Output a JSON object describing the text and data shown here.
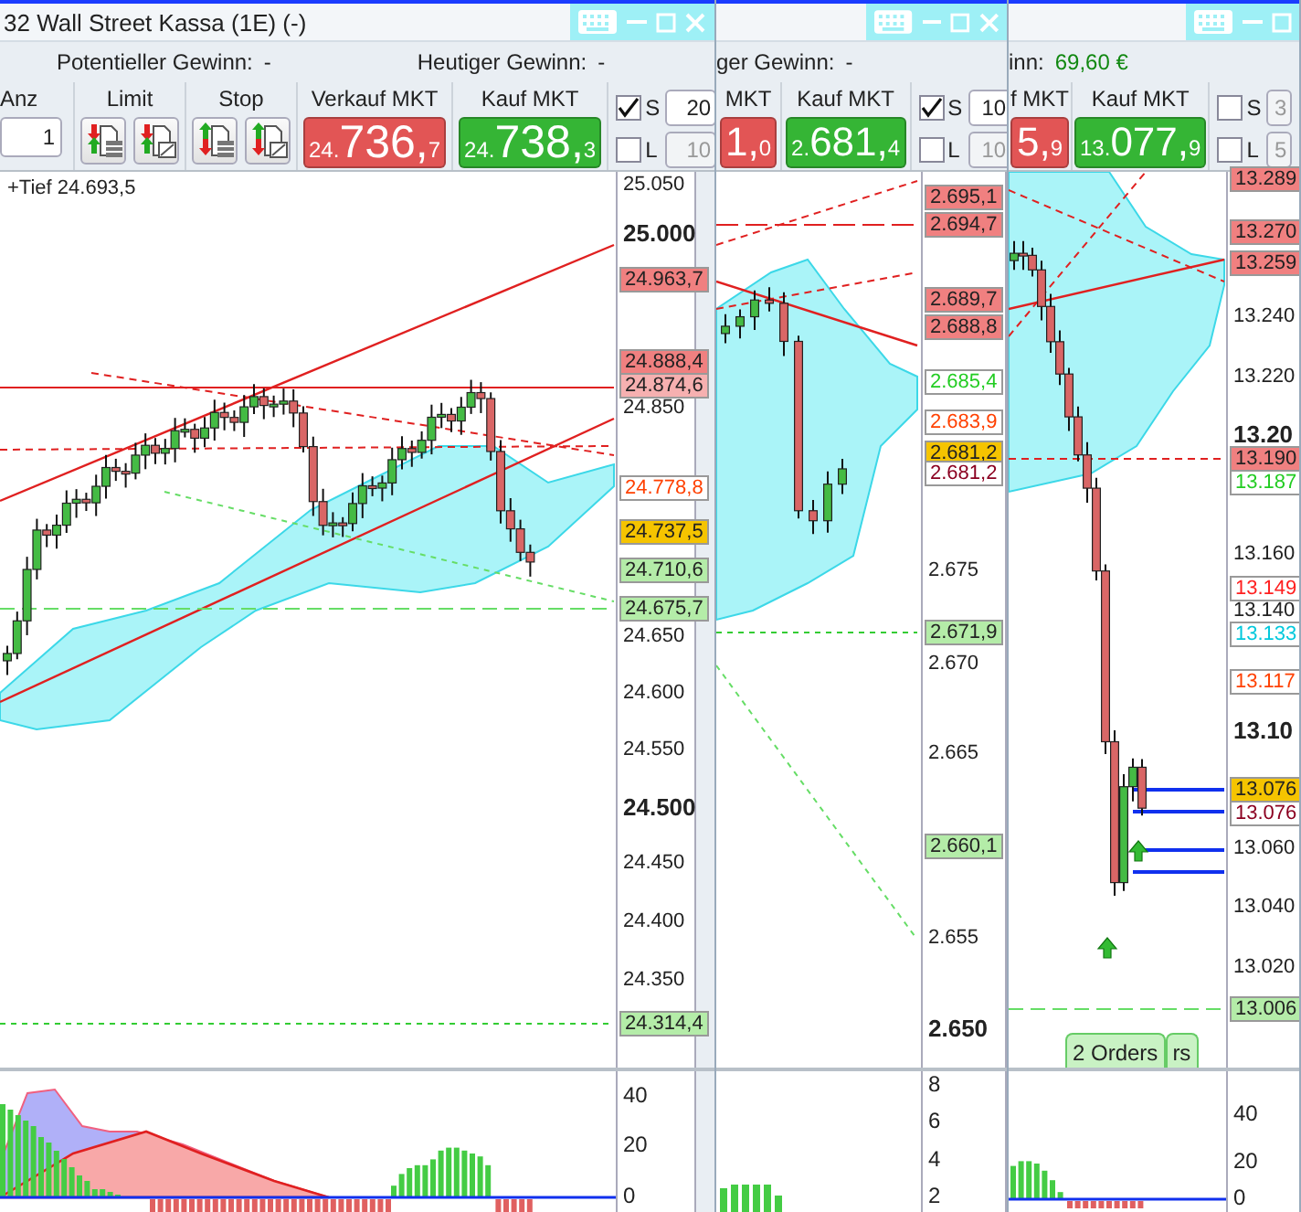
{
  "windows": [
    {
      "title": "32 Wall Street Kassa (1E) (-)",
      "info": [
        {
          "label": "Potentieller Gewinn:",
          "value": "-",
          "positive": false
        },
        {
          "label": "Heutiger Gewinn:",
          "value": "-",
          "positive": false
        }
      ],
      "toolbar": [
        {
          "kind": "quantity",
          "label": "Anz",
          "value": "1"
        },
        {
          "kind": "limit-group",
          "label": "Limit"
        },
        {
          "kind": "stop-group",
          "label": "Stop"
        },
        {
          "kind": "sell-price",
          "label": "Verkauf MKT",
          "small": "24.",
          "big": "736,",
          "sup": "7"
        },
        {
          "kind": "buy-price",
          "label": "Kauf MKT",
          "small": "24.",
          "big": "738,",
          "sup": "3"
        },
        {
          "kind": "toggles",
          "items": [
            {
              "label": "S",
              "checked": true,
              "value": "20",
              "disabled": false
            },
            {
              "label": "L",
              "checked": false,
              "value": "10",
              "disabled": true
            }
          ]
        }
      ],
      "annotation": "+Tief 24.693,5",
      "axis": [
        {
          "kind": "tick",
          "text": "25.050"
        },
        {
          "kind": "major",
          "text": "25.000"
        },
        {
          "kind": "tag",
          "text": "24.963,7",
          "color": "#f08080",
          "filled": true
        },
        {
          "kind": "tag",
          "text": "24.888,4",
          "color": "#f08080",
          "filled": true
        },
        {
          "kind": "tag",
          "text": "24.874,6",
          "color": "#f6b0b0",
          "filled": true
        },
        {
          "kind": "tick",
          "text": "24.850"
        },
        {
          "kind": "tag",
          "text": "24.778,8",
          "color": "#ff4000",
          "filled": false
        },
        {
          "kind": "tag",
          "text": "24.737,5",
          "color": "#f5c400",
          "filled": true
        },
        {
          "kind": "tag",
          "text": "24.710,6",
          "color": "#b4eca8",
          "filled": true
        },
        {
          "kind": "tag",
          "text": "24.675,7",
          "color": "#b4eca8",
          "filled": true
        },
        {
          "kind": "tick",
          "text": "24.650"
        },
        {
          "kind": "tick",
          "text": "24.600"
        },
        {
          "kind": "tick",
          "text": "24.550"
        },
        {
          "kind": "major",
          "text": "24.500"
        },
        {
          "kind": "tick",
          "text": "24.450"
        },
        {
          "kind": "tick",
          "text": "24.400"
        },
        {
          "kind": "tick",
          "text": "24.350"
        },
        {
          "kind": "tag",
          "text": "24.314,4",
          "color": "#b4eca8",
          "filled": true
        }
      ],
      "indicator_axis": [
        "40",
        "20",
        "0"
      ]
    },
    {
      "info": [
        {
          "label": "ger Gewinn:",
          "value": "-",
          "positive": false
        }
      ],
      "toolbar": [
        {
          "kind": "sell-price",
          "label": "MKT",
          "big": "1,",
          "sup": "0"
        },
        {
          "kind": "buy-price",
          "label": "Kauf MKT",
          "small": "2.",
          "big": "681,",
          "sup": "4"
        },
        {
          "kind": "toggles",
          "items": [
            {
              "label": "S",
              "checked": true,
              "value": "10",
              "disabled": false
            },
            {
              "label": "L",
              "checked": false,
              "value": "10",
              "disabled": true
            }
          ]
        }
      ],
      "axis": [
        {
          "kind": "tag",
          "text": "2.695,1",
          "color": "#f08080",
          "filled": true
        },
        {
          "kind": "tag",
          "text": "2.694,7",
          "color": "#f08080",
          "filled": true
        },
        {
          "kind": "tag",
          "text": "2.689,7",
          "color": "#f08080",
          "filled": true
        },
        {
          "kind": "tag",
          "text": "2.688,8",
          "color": "#f08080",
          "filled": true
        },
        {
          "kind": "tag",
          "text": "2.685,4",
          "color": "#22cc22",
          "filled": false
        },
        {
          "kind": "tag",
          "text": "2.683,9",
          "color": "#ff4000",
          "filled": false
        },
        {
          "kind": "tag",
          "text": "2.681,2",
          "color": "#f5c400",
          "filled": true
        },
        {
          "kind": "tag",
          "text": "2.681,2",
          "color": "#8b0020",
          "filled": false
        },
        {
          "kind": "tick",
          "text": "2.675"
        },
        {
          "kind": "tag",
          "text": "2.671,9",
          "color": "#b4eca8",
          "filled": true
        },
        {
          "kind": "tick",
          "text": "2.670"
        },
        {
          "kind": "tick",
          "text": "2.665"
        },
        {
          "kind": "tag",
          "text": "2.660,1",
          "color": "#b4eca8",
          "filled": true
        },
        {
          "kind": "tick",
          "text": "2.655"
        },
        {
          "kind": "major",
          "text": "2.650"
        }
      ],
      "indicator_axis": [
        "8",
        "6",
        "4",
        "2"
      ]
    },
    {
      "info": [
        {
          "label": "inn:",
          "value": "69,60 €",
          "positive": true
        }
      ],
      "toolbar": [
        {
          "kind": "sell-price",
          "label": "f MKT",
          "big": "5,",
          "sup": "9"
        },
        {
          "kind": "buy-price",
          "label": "Kauf MKT",
          "small": "13.",
          "big": "077,",
          "sup": "9"
        },
        {
          "kind": "toggles",
          "items": [
            {
              "label": "S",
              "checked": false,
              "value": "3",
              "disabled": true
            },
            {
              "label": "L",
              "checked": false,
              "value": "5",
              "disabled": true
            }
          ]
        }
      ],
      "axis": [
        {
          "kind": "tag",
          "text": "13.289",
          "color": "#f08080",
          "filled": true
        },
        {
          "kind": "tag",
          "text": "13.270",
          "color": "#f08080",
          "filled": true
        },
        {
          "kind": "tag",
          "text": "13.259",
          "color": "#f08080",
          "filled": true
        },
        {
          "kind": "tick",
          "text": "13.240"
        },
        {
          "kind": "tick",
          "text": "13.220"
        },
        {
          "kind": "major",
          "text": "13.20"
        },
        {
          "kind": "tag",
          "text": "13.190",
          "color": "#f08080",
          "filled": true
        },
        {
          "kind": "tag",
          "text": "13.187",
          "color": "#22cc22",
          "filled": false
        },
        {
          "kind": "tick",
          "text": "13.160"
        },
        {
          "kind": "tag",
          "text": "13.149",
          "color": "#ff2020",
          "filled": false
        },
        {
          "kind": "tick",
          "text": "13.140"
        },
        {
          "kind": "tag",
          "text": "13.133",
          "color": "#00c8dc",
          "filled": false
        },
        {
          "kind": "tag",
          "text": "13.117",
          "color": "#ff4000",
          "filled": false
        },
        {
          "kind": "major",
          "text": "13.10"
        },
        {
          "kind": "tag",
          "text": "13.076",
          "color": "#f5c400",
          "filled": true
        },
        {
          "kind": "tag",
          "text": "13.076",
          "color": "#8b0020",
          "filled": false
        },
        {
          "kind": "tick",
          "text": "13.060"
        },
        {
          "kind": "tick",
          "text": "13.040"
        },
        {
          "kind": "tick",
          "text": "13.020"
        },
        {
          "kind": "tag",
          "text": "13.006",
          "color": "#b4eca8",
          "filled": true
        }
      ],
      "orders_tabs": [
        "2 Orders",
        "rs"
      ],
      "indicator_axis": [
        "40",
        "20",
        "0"
      ]
    }
  ]
}
